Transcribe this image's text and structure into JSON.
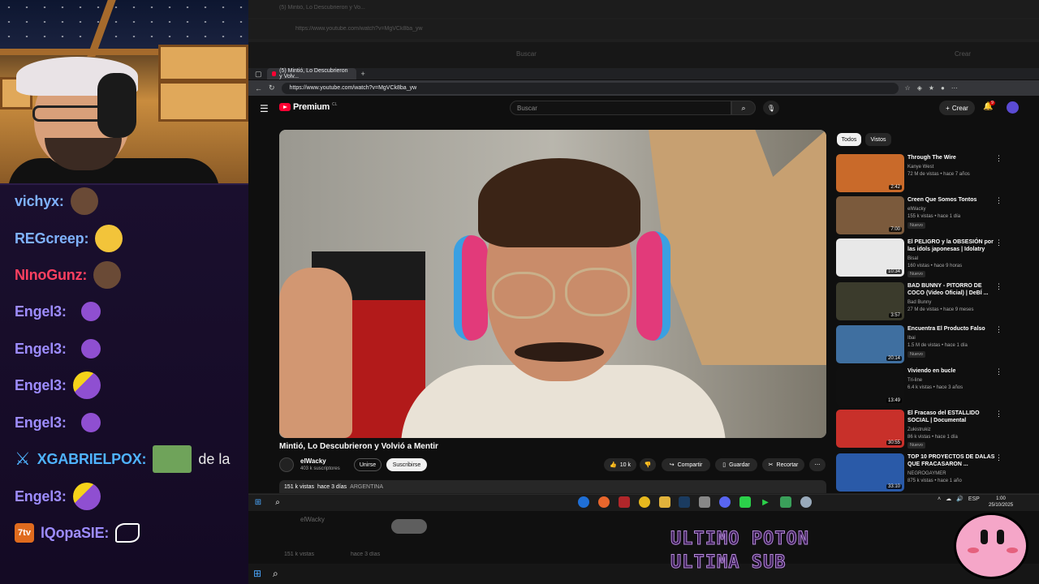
{
  "chat": [
    {
      "user": "vichyx:",
      "color": "#7fb2ff",
      "msg": "",
      "emote": "#6a4a36"
    },
    {
      "user": "REGcreep:",
      "color": "#7fb2ff",
      "msg": "",
      "emote": "#f2c43a"
    },
    {
      "user": "NInoGunz:",
      "color": "#ff4060",
      "msg": "",
      "emote": "#6a4a36"
    },
    {
      "user": "Engel3:",
      "color": "#9d8cff",
      "msg": "",
      "emote": "#8f4fd1"
    },
    {
      "user": "Engel3:",
      "color": "#9d8cff",
      "msg": "",
      "emote": "#8f4fd1"
    },
    {
      "user": "Engel3:",
      "color": "#9d8cff",
      "msg": "",
      "emote": "#8f4fd1"
    },
    {
      "user": "Engel3:",
      "color": "#9d8cff",
      "msg": "",
      "emote": "#8f4fd1"
    },
    {
      "user": "XGABRIELPOX:",
      "color": "#4fb3ff",
      "msg": "de la",
      "emote": "#6fa35a"
    },
    {
      "user": "Engel3:",
      "color": "#9d8cff",
      "msg": "",
      "emote": "#8f4fd1"
    },
    {
      "user": "lQopaSIE:",
      "color": "#9d8cff",
      "msg": "",
      "emote": "#ffffff",
      "badge": "7tv"
    }
  ],
  "outer": {
    "tab_title": "(5) Mintió, Lo Descubrieron y Vo...",
    "url": "https://www.youtube.com/watch?v=MgVCk8ba_yw",
    "search_placeholder": "Buscar",
    "create": "Crear"
  },
  "browser": {
    "tab_title": "(5) Mintió, Lo Descubrieron y Volv...",
    "url": "https://www.youtube.com/watch?v=MgVCk8ba_yw"
  },
  "youtube": {
    "logo": "Premium",
    "logo_suffix": "CL",
    "search_placeholder": "Buscar",
    "create": "Crear",
    "notifications": "9"
  },
  "video": {
    "title": "Mintió, Lo Descubrieron y Volvió a Mentir",
    "channel": "elWacky",
    "subscribers": "403 k suscriptores",
    "join": "Unirse",
    "subscribe": "Suscribirse",
    "likes": "10 k",
    "share": "Compartir",
    "save": "Guardar",
    "clip": "Recortar",
    "views": "151 k vistas",
    "date": "hace 3 días",
    "country": "ARGENTINA"
  },
  "filters": {
    "all": "Todos",
    "seen": "Vistos"
  },
  "recommendations": [
    {
      "title": "Through The Wire",
      "channel": "Kanye West",
      "meta": "72 M de vistas • hace 7 años",
      "duration": "2:42",
      "new": "",
      "thumb": "#c96a2a"
    },
    {
      "title": "Creen Que Somos Tontos",
      "channel": "elWacky",
      "meta": "155 k vistas • hace 1 día",
      "duration": "7:00",
      "new": "Nuevo",
      "thumb": "#7b5a3c"
    },
    {
      "title": "El PELIGRO y la OBSESIÓN por las idols japonesas | Idolatry",
      "channel": "Bisal",
      "meta": "160 vistas • hace 9 horas",
      "duration": "10:34",
      "new": "Nuevo",
      "thumb": "#e8e8e8"
    },
    {
      "title": "BAD BUNNY - PITORRO DE COCO (Video Oficial) | DeBÍ ...",
      "channel": "Bad Bunny",
      "meta": "27 M de vistas • hace 9 meses",
      "duration": "3:57",
      "new": "",
      "thumb": "#3b3b2c"
    },
    {
      "title": "Encuentra El Producto Falso",
      "channel": "Ibai",
      "meta": "1.5 M de vistas • hace 1 día",
      "duration": "20:14",
      "new": "Nuevo",
      "thumb": "#3f6fa0"
    },
    {
      "title": "Viviendo en bucle",
      "channel": "Tri-line",
      "meta": "6.4 k vistas • hace 3 años",
      "duration": "13:49",
      "new": "",
      "thumb": "#101010"
    },
    {
      "title": "El Fracaso del ESTALLIDO SOCIAL | Documental",
      "channel": "Zukistrukiz",
      "meta": "86 k vistas • hace 1 día",
      "duration": "30:55",
      "new": "Nuevo",
      "thumb": "#c8302a"
    },
    {
      "title": "TOP 10 PROYECTOS DE DALAS QUE FRACASARON ...",
      "channel": "NEGROGAYMER",
      "meta": "875 k vistas • hace 1 año",
      "duration": "33:10",
      "new": "",
      "thumb": "#2a5aa8"
    }
  ],
  "taskbar": {
    "lang": "ESP",
    "time": "1:00",
    "date": "25/10/2025"
  },
  "overlay": {
    "line1": "ULTIMO POTON",
    "line2": "ULTIMA SUB"
  }
}
